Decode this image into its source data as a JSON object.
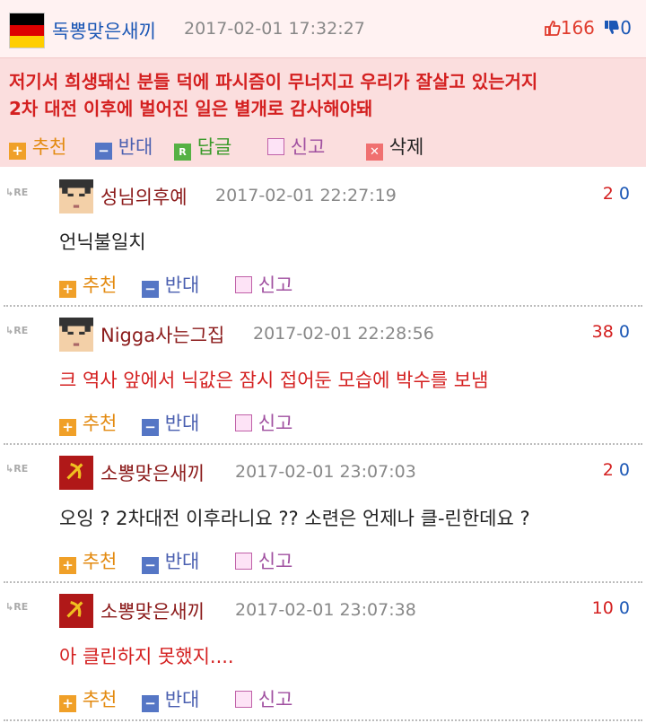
{
  "post": {
    "author": "독뽕맞은새끼",
    "timestamp": "2017-02-01 17:32:27",
    "likes": "166",
    "dislikes": "0",
    "body_lines": [
      "저기서 희생돼신 분들 덕에 파시즘이 무너지고 우리가 잘살고 있는거지",
      "2차 대전 이후에 벌어진 일은 별개로 감사해야돼"
    ],
    "actions": {
      "recommend": "추천",
      "oppose": "반대",
      "reply": "답글",
      "report": "신고",
      "delete": "삭제"
    },
    "flag_colors": [
      "#000000",
      "#dd0000",
      "#ffce00"
    ]
  },
  "comment_actions": {
    "recommend": "추천",
    "oppose": "반대",
    "report": "신고"
  },
  "re_label": "RE",
  "comments": [
    {
      "author": "성님의후예",
      "timestamp": "2017-02-01 22:27:19",
      "up": "2",
      "down": "0",
      "text": "언닉불일치",
      "text_color": "#222222",
      "avatar": "pixel-face"
    },
    {
      "author": "Nigga사는그집",
      "timestamp": "2017-02-01 22:28:56",
      "up": "38",
      "down": "0",
      "text": "크 역사 앞에서 닉값은 잠시 접어둔 모습에 박수를 보냄",
      "text_color": "#d42020",
      "avatar": "pixel-face"
    },
    {
      "author": "소뽕맞은새끼",
      "timestamp": "2017-02-01 23:07:03",
      "up": "2",
      "down": "0",
      "text": "오잉 ? 2차대전 이후라니요 ?? 소련은 언제나 클-린한데요 ?",
      "text_color": "#222222",
      "avatar": "soviet-flag"
    },
    {
      "author": "소뽕맞은새끼",
      "timestamp": "2017-02-01 23:07:38",
      "up": "10",
      "down": "0",
      "text": "아 클린하지 못했지....",
      "text_color": "#d42020",
      "avatar": "soviet-flag"
    }
  ]
}
